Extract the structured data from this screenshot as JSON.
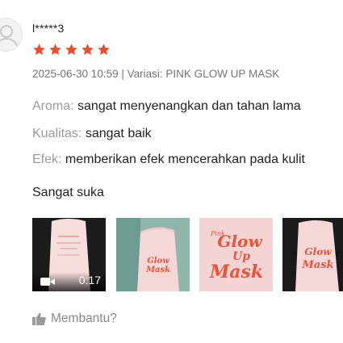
{
  "reviewer": {
    "username": "l*****3",
    "rating": 5
  },
  "meta": {
    "date": "2025-06-30 10:59",
    "separator": "|",
    "variation_label": "Variasi:",
    "variation_value": "PINK GLOW UP MASK"
  },
  "attributes": [
    {
      "key": "Aroma:",
      "value": "sangat menyenangkan dan tahan lama"
    },
    {
      "key": "Kualitas:",
      "value": "sangat baik"
    },
    {
      "key": "Efek:",
      "value": "memberikan efek mencerahkan pada kulit"
    }
  ],
  "comment": "Sangat suka",
  "media": [
    {
      "type": "video",
      "duration": "0:17"
    },
    {
      "type": "image"
    },
    {
      "type": "image"
    },
    {
      "type": "image"
    }
  ],
  "product_print": {
    "line1": "Pink",
    "line2": "Glow",
    "line3": "Up",
    "line4": "Mask"
  },
  "helpful": {
    "label": "Membantu?"
  },
  "colors": {
    "star": "#ee4d2d",
    "muted_text": "#757575",
    "attr_key": "#9a9a9a",
    "print_red": "#e8553c",
    "tube_pink": "#f6d7d7"
  }
}
